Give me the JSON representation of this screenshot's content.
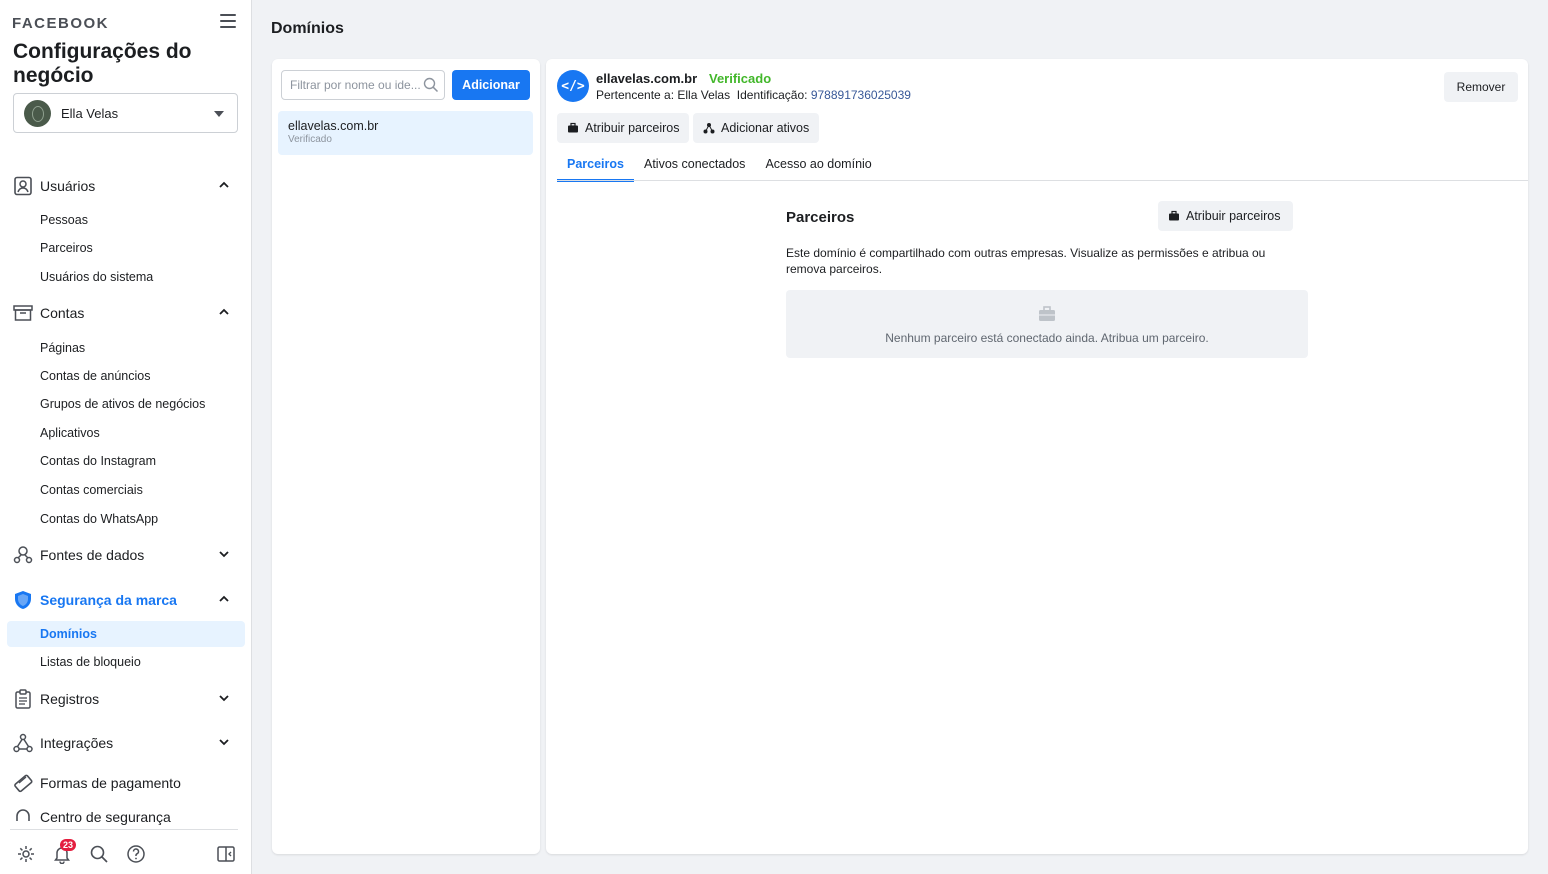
{
  "sidebar": {
    "brand": "FACEBOOK",
    "title": "Configurações do negócio",
    "business": {
      "name": "Ella Velas"
    },
    "sections": [
      {
        "label": "Usuários",
        "items": [
          "Pessoas",
          "Parceiros",
          "Usuários do sistema"
        ]
      },
      {
        "label": "Contas",
        "items": [
          "Páginas",
          "Contas de anúncios",
          "Grupos de ativos de negócios",
          "Aplicativos",
          "Contas do Instagram",
          "Contas comerciais",
          "Contas do WhatsApp"
        ]
      },
      {
        "label": "Fontes de dados"
      },
      {
        "label": "Segurança da marca",
        "items": [
          "Domínios",
          "Listas de bloqueio"
        ]
      },
      {
        "label": "Registros"
      },
      {
        "label": "Integrações"
      },
      {
        "label": "Formas de pagamento"
      },
      {
        "label": "Centro de segurança"
      }
    ],
    "notifications_count": "23"
  },
  "page": {
    "title": "Domínios"
  },
  "list": {
    "filter_placeholder": "Filtrar por nome ou ide...",
    "add_label": "Adicionar",
    "items": [
      {
        "name": "ellavelas.com.br",
        "status": "Verificado"
      }
    ]
  },
  "detail": {
    "domain": "ellavelas.com.br",
    "status": "Verificado",
    "owner_prefix": "Pertencente a: Ella Velas",
    "id_prefix": "Identificação:",
    "id": "978891736025039",
    "remove_label": "Remover",
    "assign_partners_label": "Atribuir parceiros",
    "add_assets_label": "Adicionar ativos",
    "tabs": [
      "Parceiros",
      "Ativos conectados",
      "Acesso ao domínio"
    ],
    "partners": {
      "title": "Parceiros",
      "assign_label": "Atribuir parceiros",
      "description": "Este domínio é compartilhado com outras empresas. Visualize as permissões e atribua ou remova parceiros.",
      "empty_text": "Nenhum parceiro está conectado ainda. Atribua um parceiro."
    }
  },
  "colors": {
    "accent": "#1877f2",
    "verified": "#42b72a",
    "link": "#385898",
    "badge": "#e41e3f"
  }
}
